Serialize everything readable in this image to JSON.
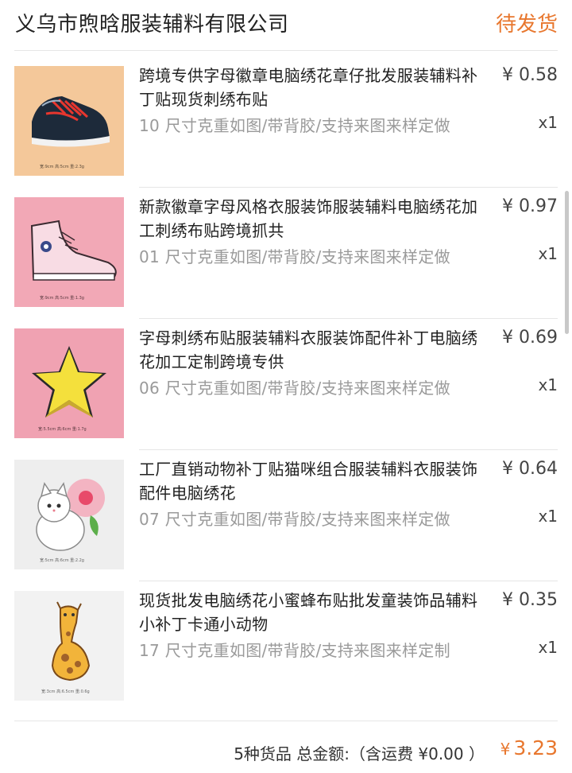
{
  "header": {
    "shop_name": "义乌市煦晗服装辅料有限公司",
    "status": "待发货"
  },
  "items": [
    {
      "title": "跨境专供字母徽章电脑绣花章仔批发服装辅料补丁贴现货刺绣布贴",
      "spec": "10 尺寸克重如图/带背胶/支持来图来样定做",
      "price": "¥ 0.58",
      "qty": "x1",
      "thumb_icon": "sneaker-patch",
      "thumb_caption": "宽:9cm  高:5cm  重:2.3g",
      "thumb_bg": "#f4c89a"
    },
    {
      "title": "新款徽章字母风格衣服装饰服装辅料电脑绣花加工刺绣布贴跨境抓共",
      "spec": "01 尺寸克重如图/带背胶/支持来图来样定做",
      "price": "¥ 0.97",
      "qty": "x1",
      "thumb_icon": "pink-hightop-patch",
      "thumb_caption": "宽:9cm  高:5cm  重:1.3g",
      "thumb_bg": "#f2a8b6"
    },
    {
      "title": "字母刺绣布贴服装辅料衣服装饰配件补丁电脑绣花加工定制跨境专供",
      "spec": "06 尺寸克重如图/带背胶/支持来图来样定做",
      "price": "¥ 0.69",
      "qty": "x1",
      "thumb_icon": "star-patch",
      "thumb_caption": "宽:5.5cm  高:6cm  重:1.7g",
      "thumb_bg": "#f0a2b2"
    },
    {
      "title": "工厂直销动物补丁贴猫咪组合服装辅料衣服装饰配件电脑绣花",
      "spec": "07 尺寸克重如图/带背胶/支持来图来样定做",
      "price": "¥ 0.64",
      "qty": "x1",
      "thumb_icon": "cat-flower-patch",
      "thumb_caption": "宽:5cm  高:6cm  重:2.2g",
      "thumb_bg": "#eeeeee"
    },
    {
      "title": "现货批发电脑绣花小蜜蜂布贴批发童装饰品辅料小补丁卡通小动物",
      "spec": "17 尺寸克重如图/带背胶/支持来图来样定制",
      "price": "¥ 0.35",
      "qty": "x1",
      "thumb_icon": "giraffe-patch",
      "thumb_caption": "宽:3cm  高:6.5cm  重:0.6g",
      "thumb_bg": "#f2f2f2"
    }
  ],
  "footer": {
    "summary": "5种货品 总金额:（含运费 ¥0.00 ）",
    "total_symbol": "¥",
    "total_value": "3.23"
  },
  "colors": {
    "accent": "#e8772e",
    "muted_text": "#9a9a9a",
    "divider": "#e6e6e6"
  }
}
